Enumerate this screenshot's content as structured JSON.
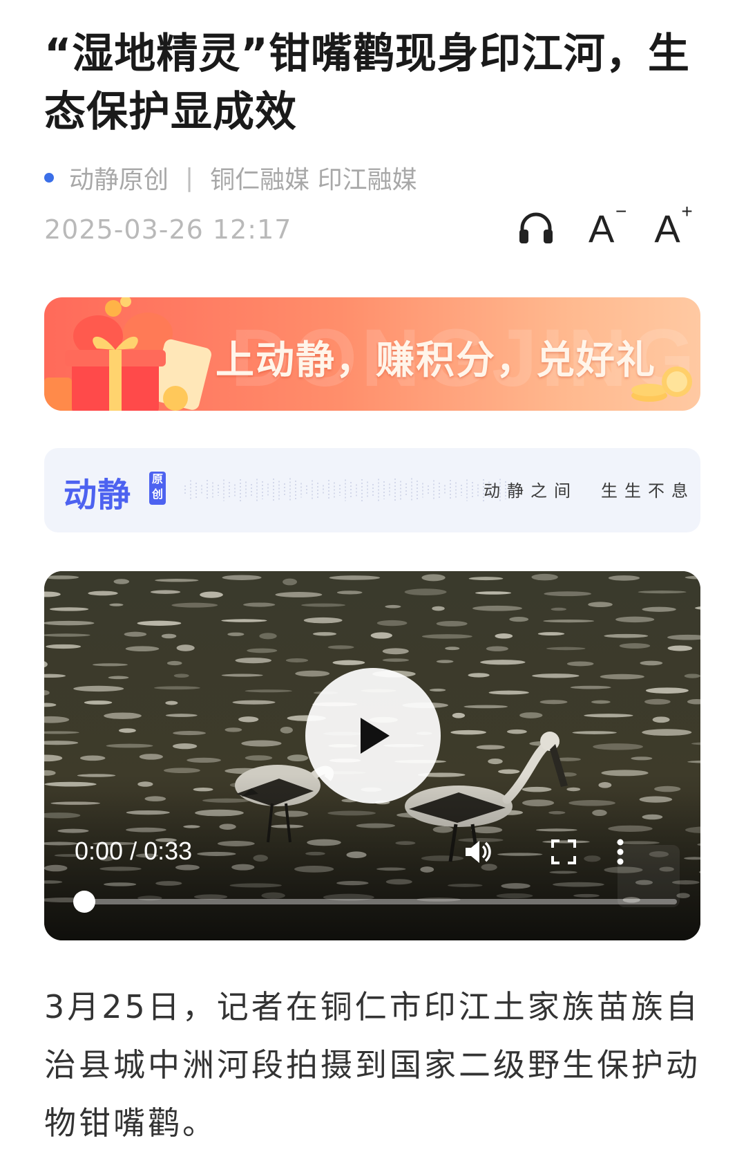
{
  "article": {
    "title": "“湿地精灵”钳嘴鹳现身印江河，生态保护显成效",
    "source": "动静原创",
    "separator": "|",
    "publishers": "铜仁融媒 印江融媒",
    "date": "2025-03-26 12:17",
    "body": "3月25日，记者在铜仁市印江土家族苗族自治县城中洲河段拍摄到国家二级野生保护动物钳嘴鹳。"
  },
  "tools": {
    "audio_icon": "headphones-icon",
    "font_smaller": "A",
    "font_smaller_mark": "−",
    "font_larger": "A",
    "font_larger_mark": "+"
  },
  "banner": {
    "text": "上动静，赚积分，兑好礼",
    "watermark": "DONGJING"
  },
  "brand_bar": {
    "logo": "动静",
    "badge_line1": "原",
    "badge_line2": "创",
    "slogan_left": "动静之间",
    "slogan_right": "生生不息"
  },
  "video": {
    "current_time": "0:00",
    "time_separator": " / ",
    "duration": "0:33",
    "progress": 0,
    "icons": [
      "play-icon",
      "volume-icon",
      "fullscreen-icon",
      "more-vertical-icon"
    ]
  },
  "colors": {
    "accent_blue": "#3b6fe8",
    "brand_blue": "#4d62f0",
    "banner_start": "#ff6a5a",
    "banner_end": "#ffc9a2"
  }
}
